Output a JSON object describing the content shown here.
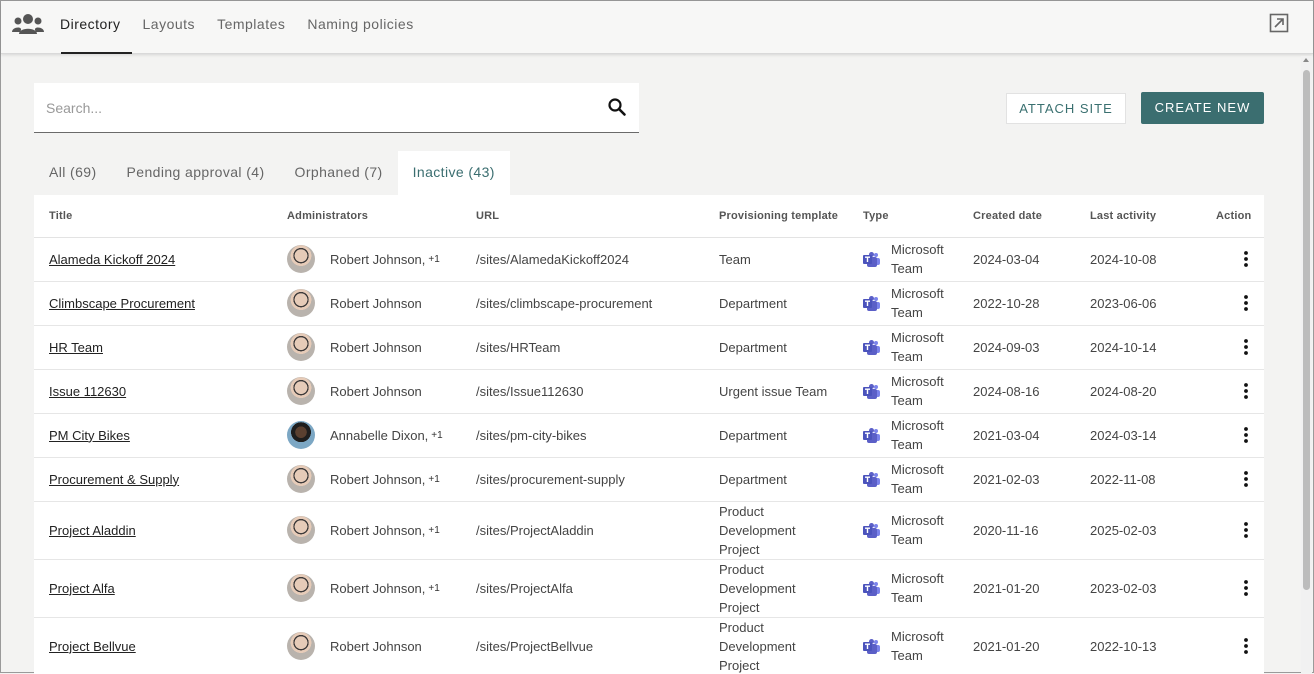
{
  "nav": {
    "app_icon": "people-group-icon",
    "tabs": [
      "Directory",
      "Layouts",
      "Templates",
      "Naming policies"
    ],
    "active_tab": "Directory",
    "popout_icon": "open-external-icon"
  },
  "search": {
    "placeholder": "Search...",
    "value": "",
    "icon": "search-icon"
  },
  "buttons": {
    "attach_site": "ATTACH SITE",
    "create_new": "CREATE NEW"
  },
  "filter_tabs": [
    {
      "label": "All (69)"
    },
    {
      "label": "Pending approval (4)"
    },
    {
      "label": "Orphaned (7)"
    },
    {
      "label": "Inactive (43)",
      "active": true
    }
  ],
  "table": {
    "columns": [
      "Title",
      "Administrators",
      "URL",
      "Provisioning template",
      "Type",
      "Created date",
      "Last activity",
      "Action"
    ],
    "rows": [
      {
        "title": "Alameda Kickoff 2024",
        "admin": "Robert Johnson,",
        "admin_extra": "+1",
        "url": "/sites/AlamedaKickoff2024",
        "template": "Team",
        "type": "Microsoft Team",
        "created": "2024-03-04",
        "last_activity": "2024-10-08"
      },
      {
        "title": "Climbscape Procurement",
        "admin": "Robert Johnson",
        "admin_extra": "",
        "url": "/sites/climbscape-procurement",
        "template": "Department",
        "type": "Microsoft Team",
        "created": "2022-10-28",
        "last_activity": "2023-06-06"
      },
      {
        "title": "HR Team",
        "admin": "Robert Johnson",
        "admin_extra": "",
        "url": "/sites/HRTeam",
        "template": "Department",
        "type": "Microsoft Team",
        "created": "2024-09-03",
        "last_activity": "2024-10-14"
      },
      {
        "title": "Issue 112630",
        "admin": "Robert Johnson",
        "admin_extra": "",
        "url": "/sites/Issue112630",
        "template": "Urgent issue Team",
        "type": "Microsoft Team",
        "created": "2024-08-16",
        "last_activity": "2024-08-20"
      },
      {
        "title": "PM City Bikes",
        "admin": "Annabelle Dixon,",
        "admin_extra": "+1",
        "url": "/sites/pm-city-bikes",
        "template": "Department",
        "type": "Microsoft Team",
        "created": "2021-03-04",
        "last_activity": "2024-03-14"
      },
      {
        "title": "Procurement & Supply",
        "admin": "Robert Johnson,",
        "admin_extra": "+1",
        "url": "/sites/procurement-supply",
        "template": "Department",
        "type": "Microsoft Team",
        "created": "2021-02-03",
        "last_activity": "2022-11-08"
      },
      {
        "title": "Project Aladdin",
        "admin": "Robert Johnson,",
        "admin_extra": "+1",
        "url": "/sites/ProjectAladdin",
        "template": "Product Development Project",
        "type": "Microsoft Team",
        "created": "2020-11-16",
        "last_activity": "2025-02-03"
      },
      {
        "title": "Project Alfa",
        "admin": "Robert Johnson,",
        "admin_extra": "+1",
        "url": "/sites/ProjectAlfa",
        "template": "Product Development Project",
        "type": "Microsoft Team",
        "created": "2021-01-20",
        "last_activity": "2023-02-03"
      },
      {
        "title": "Project Bellvue",
        "admin": "Robert Johnson",
        "admin_extra": "",
        "url": "/sites/ProjectBellvue",
        "template": "Product Development Project",
        "type": "Microsoft Team",
        "created": "2021-01-20",
        "last_activity": "2022-10-13"
      }
    ]
  },
  "colors": {
    "accent": "#3b6e70",
    "teams": "#5b5fc7"
  }
}
